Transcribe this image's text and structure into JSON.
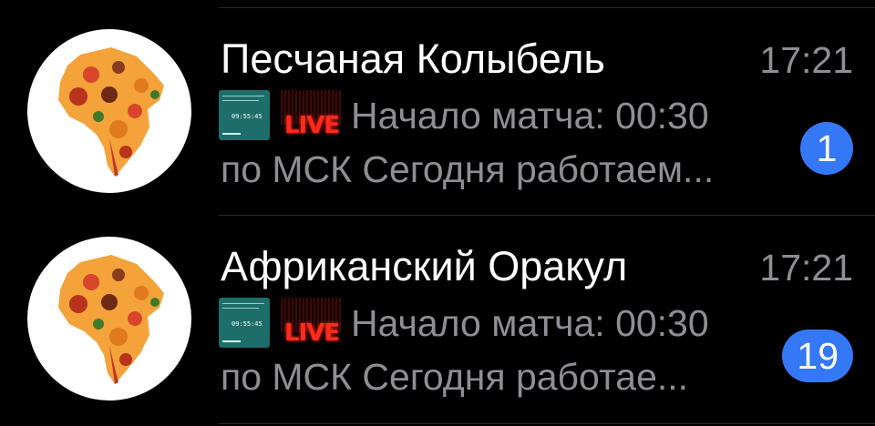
{
  "chats": [
    {
      "name": "Песчаная Колыбель",
      "time": "17:21",
      "live_label": "LIVE",
      "thumb_time": "09:55:45",
      "message_line1": "Начало матча: 00:30",
      "message_line2": "по МСК Сегодня работаем...",
      "unread": "1",
      "avatar_icon": "africa-map-icon"
    },
    {
      "name": "Африканский Оракул",
      "time": "17:21",
      "live_label": "LIVE",
      "thumb_time": "09:55:45",
      "message_line1": "Начало матча: 00:30",
      "message_line2": "по МСК Сегодня работае...",
      "unread": "19",
      "avatar_icon": "africa-map-icon"
    }
  ],
  "colors": {
    "background": "#000000",
    "secondary_text": "#8e8e93",
    "badge": "#3478f6",
    "live": "#ff2a1a"
  }
}
